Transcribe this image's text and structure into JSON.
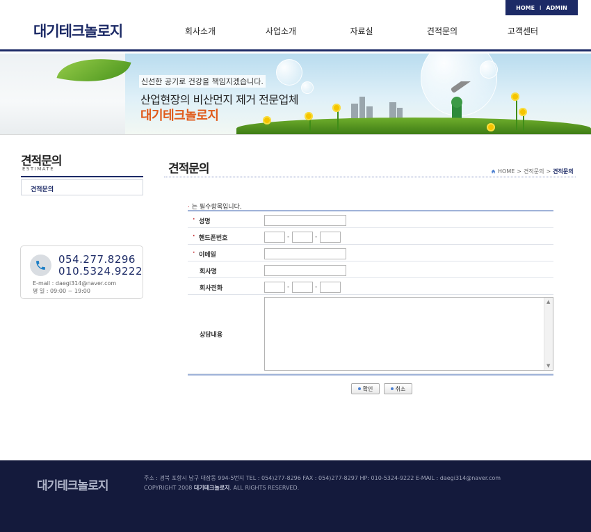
{
  "header": {
    "logo": "대기테크놀로지",
    "utility": {
      "home": "HOME",
      "separator": "I",
      "admin": "ADMIN"
    },
    "nav": [
      "회사소개",
      "사업소개",
      "자료실",
      "견적문의",
      "고객센터"
    ]
  },
  "banner": {
    "line1": "신선한 공기로 건강을 책임지겠습니다.",
    "line2": "산업현장의 비산먼지 제거 전문업체",
    "line3": "대기테크놀로지"
  },
  "sidebar": {
    "title": "견적문의",
    "subtitle": "ESTIMATE",
    "menu": [
      "견적문의"
    ],
    "contact": {
      "phone1": "054.277.8296",
      "phone2": "010.5324.9222",
      "email": "E-mail : daegi314@naver.com",
      "hours": "평    일 : 09:00 ~ 19:00"
    }
  },
  "main": {
    "title": "견적문의",
    "breadcrumb": {
      "home": "HOME",
      "level1": "견적문의",
      "current": "견적문의"
    },
    "required_note": "는 필수항목입니다.",
    "required_mark": "·",
    "form": {
      "name_label": "성명",
      "mobile_label": "핸드폰번호",
      "email_label": "이메일",
      "company_label": "회사명",
      "company_phone_label": "회사전화",
      "content_label": "상담내용",
      "phone_separator": "-"
    },
    "buttons": {
      "confirm": "확인",
      "cancel": "취소"
    }
  },
  "footer": {
    "logo": "대기테크놀로지",
    "address": "주소 : 경북 포항시 남구 대잠동 994-5번지 TEL : 054)277-8296 FAX : 054)277-8297 HP: 010-5324-9222 E-MAIL : daegi314@naver.com",
    "copyright_prefix": "COPYRIGHT 2008",
    "copyright_company": "대기테크놀로지",
    "copyright_suffix": ". ALL RIGHTS RESERVED."
  },
  "colors": {
    "brand_navy": "#1c2a66",
    "accent_orange": "#e05a1a",
    "required_red": "#c1272d"
  }
}
